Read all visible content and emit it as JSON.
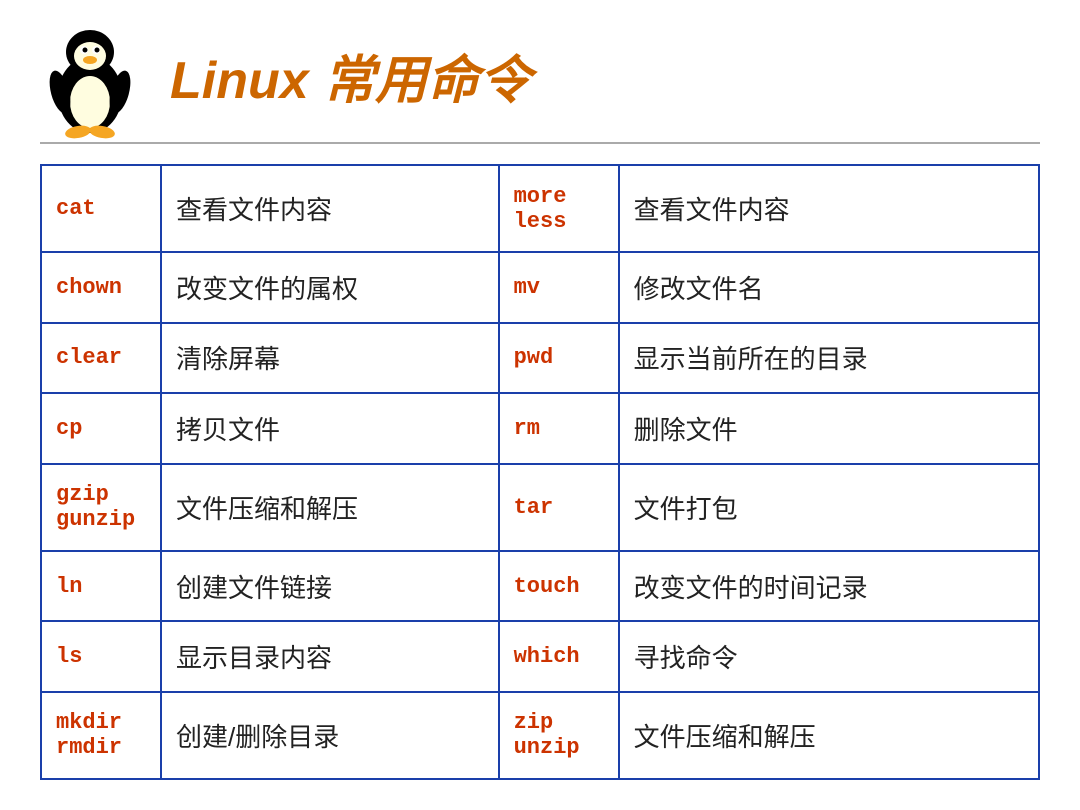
{
  "header": {
    "title": "Linux 常用命令"
  },
  "table": {
    "rows": [
      {
        "cmd1": "cat",
        "desc1": "查看文件内容",
        "cmd2": "more\nless",
        "desc2": "查看文件内容"
      },
      {
        "cmd1": "chown",
        "desc1": "改变文件的属权",
        "cmd2": "mv",
        "desc2": "修改文件名"
      },
      {
        "cmd1": "clear",
        "desc1": "清除屏幕",
        "cmd2": "pwd",
        "desc2": "显示当前所在的目录"
      },
      {
        "cmd1": "cp",
        "desc1": "拷贝文件",
        "cmd2": "rm",
        "desc2": "删除文件"
      },
      {
        "cmd1": "gzip\ngunzip",
        "desc1": "文件压缩和解压",
        "cmd2": "tar",
        "desc2": "文件打包"
      },
      {
        "cmd1": "ln",
        "desc1": "创建文件链接",
        "cmd2": "touch",
        "desc2": "改变文件的时间记录"
      },
      {
        "cmd1": "ls",
        "desc1": "显示目录内容",
        "cmd2": "which",
        "desc2": "寻找命令"
      },
      {
        "cmd1": "mkdir\nrmdir",
        "desc1": "创建/删除目录",
        "cmd2": "zip\nunzip",
        "desc2": "文件压缩和解压"
      }
    ]
  }
}
